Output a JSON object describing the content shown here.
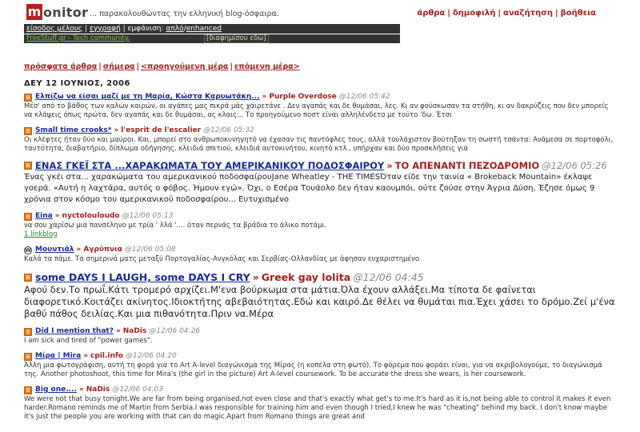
{
  "header": {
    "logo_initial": "m",
    "logo_rest": "onitor",
    "tagline": "... παρακολουθώντας την ελληνική blog-όσφαιρα.",
    "nav": [
      "άρθρα",
      "δημοφιλή",
      "αναζήτηση",
      "βοήθεια"
    ]
  },
  "userbar": {
    "login": "είσοδος μέλους",
    "register": "εγγραφή",
    "view_label": "εμφάνιση:",
    "view_simple": "απλό",
    "view_enhanced": "enhanced"
  },
  "adbar": {
    "text": "FreeStuff.gr - Tech community.",
    "disclaimer": "[διαφημίσου εδώ]"
  },
  "subnav": [
    "πρόσφατα άρθρα",
    "σήμερα",
    "<προηγούμενη μέρα",
    "επόμενη μέρα>"
  ],
  "date_heading": "ΔΕΥ 12 ΙΟΥΝΙΟΣ, 2006",
  "entries": [
    {
      "title": "Ελπίζω να είσαι μαζί με τη Μαρία, Κώστα Καρυωτάκη...",
      "blog": "Purple Overdose",
      "time": "@12/06 05:42",
      "excerpt": "Μέσ' από το βάθος των καλών καιρών, οι αγάπες μας πικρά μάς χαιρετάνε . Δεν αγαπάς και δε θυμάσαι, λες. Κι αν φούσκωσαν τα στήθη, κι αν δακρύζεις που δεν μπορείς να κλάψεις όπως πρώτα, δεν αγαπάς και δε θυμάσαι, ας κλαις... Το προηγούμενο ποστ είναι αλληλένδετο με τούτο 'δω. Έτσι"
    },
    {
      "title": "Small time crooks*",
      "blog": "l'esprit de l'escalier",
      "time": "@12/06 05:32",
      "excerpt": "Οι κλέφτες ήταν δύο και μαύροι. Και, μπορεί στο ανθρωποκυνηγητό να έχασαν τις παντόφλες τους, αλλά τουλάχιστον βούτηξαν τη σωστή τσάντα: Ανάμεσα σε πορτοφόλι, ταυτότητα, διαβατήριο, δίπλωμα οδήγησης, κλειδιά σπιτιού, κλειδιά αυτοκινήτου, κινητό κτλ., υπήρχαν και δύο προσκλήσεις για"
    },
    {
      "title": "ΕΝΑΣ ΓΚΕΪ ΣΤΑ ...ΧΑΡΑΚΩΜΑΤΑ ΤΟΥ ΑΜΕΡΙΚΑΝΙΚΟΥ ΠΟΔΟΣΦΑΙΡΟΥ",
      "blog": "ΤΟ ΑΠΕΝΑΝΤΙ ΠΕΖΟΔΡΟΜΙΟ",
      "time": "@12/06 05:26",
      "excerpt": "Ένας γκέι στα... χαρακώματα του αμερικανικού ποδοσφαίρουJane Wheatley - THE TIMESΌταν είδε την ταινία « Brokeback Mountain» έκλαψε γοερά. «Αυτή η λαχτάρα, αυτός ο φόβος. Ήμουν εγώ». Όχι, ο Εσέρα Τουάολο δεν ήταν καουμπόι, ούτε ζούσε στην Άγρια Δύση. Έζησε όμως 9 χρόνια στον κόσμο του αμερικανικού ποδοσφαίρου... Ευτυχισμένο"
    },
    {
      "title": "Eina",
      "blog": "nyctolouloudo",
      "time": "@12/06 05:13",
      "excerpt": "να σου χαρίσω μια πανσέληνο με τρία ' λλά '.... όταν περνάς τα βράδια το άλικο ποτάμι.",
      "linkblog": "1 linkblog"
    },
    {
      "title": "Μουντιάλ",
      "blog": "Αγρύπνια",
      "time": "@12/06 05:08",
      "excerpt": "Καλά τα πάμε. Τα σημερινά ματς μεταξύ Πορτογαλίας-Ανγκόλας και Σερβίας-Ολλανδίας με άφησαν ευχαριστημένο"
    },
    {
      "title": "some DAYS I LAUGH, some DAYS I CRY",
      "blog": "Greek gay lolita",
      "time": "@12/06 04:45",
      "excerpt": "Αφού δεν.Το πρωΐ.Κάτι τρομερό αρχίζει.Μ'ενα βούρκωμα στα μάτια.Όλα έχουν αλλάξει.Μα τίποτα δε φαίνεται διαφορετικό.Κοιτάζει ακίνητος.Ιδιοκτήτης αβεβαιότητας.Εδώ και καιρό.Δε θέλει να θυμάται πια.Έχει χάσει το δρόμο.Ζεί μ'ένα βαθύ πάθος δειλίας.Και μια πιθανότητα.Πριν να.Μέρα"
    },
    {
      "title": "Did I mention that?",
      "blog": "NaDis",
      "time": "@12/06 04:26",
      "excerpt": "I am sick and tired of \"power games\"."
    },
    {
      "title": "Μίρα | Mira",
      "blog": "cpil.info",
      "time": "@12/06 04:20",
      "excerpt": "Άλλη μια φωτογράφιση, αυτή τη φορά για το Art A-level διαγώνισμα της Μίρας (η κοπέλα στη φωτό). Το φόρεμα που φοράει είναι, για να ακριβολογούμε, το διαγώνισμά της. Another photoshoot, this time for Mira's (the girl in the picture) Art A-level coursework. To be accurate the dress she wears, is her coursework."
    },
    {
      "title": "Big one....",
      "blog": "NaDis",
      "time": "@12/06 04:03",
      "excerpt": "We were not that busy tonight.We are far from being organised,not even close and that's exactly what get's to me.It's hard as it is,not being able to control it makes it even harder.Romano reminds me of Martin from Serbia.I was responsible for training him and even though I tried,I knew he was \"cheating\" behind my back. I don't know maybe it's just the people you are working with that can do magic.Apart from Romano things are great and"
    }
  ]
}
